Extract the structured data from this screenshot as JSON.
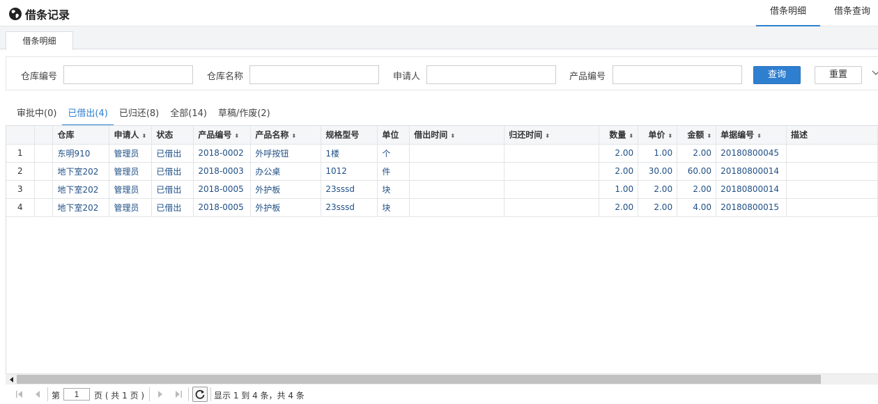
{
  "app": {
    "title": "借条记录"
  },
  "top_tabs": [
    {
      "label": "借条明细",
      "active": true
    },
    {
      "label": "借条查询",
      "active": false
    }
  ],
  "sub_tab": {
    "label": "借条明细"
  },
  "search": {
    "fields": [
      {
        "label": "仓库编号",
        "value": ""
      },
      {
        "label": "仓库名称",
        "value": ""
      },
      {
        "label": "申请人",
        "value": ""
      },
      {
        "label": "产品编号",
        "value": ""
      }
    ],
    "query_label": "查询",
    "reset_label": "重置"
  },
  "status_tabs": [
    {
      "label": "审批中(0)",
      "active": false
    },
    {
      "label": "已借出(4)",
      "active": true
    },
    {
      "label": "已归还(8)",
      "active": false
    },
    {
      "label": "全部(14)",
      "active": false
    },
    {
      "label": "草稿/作废(2)",
      "active": false
    }
  ],
  "table": {
    "columns": [
      {
        "label": "",
        "sortable": false
      },
      {
        "label": "",
        "sortable": false
      },
      {
        "label": "仓库",
        "sortable": false
      },
      {
        "label": "申请人",
        "sortable": true
      },
      {
        "label": "状态",
        "sortable": false
      },
      {
        "label": "产品编号",
        "sortable": true
      },
      {
        "label": "产品名称",
        "sortable": true
      },
      {
        "label": "规格型号",
        "sortable": false
      },
      {
        "label": "单位",
        "sortable": false
      },
      {
        "label": "借出时间",
        "sortable": true
      },
      {
        "label": "归还时间",
        "sortable": true
      },
      {
        "label": "数量",
        "sortable": true
      },
      {
        "label": "单价",
        "sortable": true
      },
      {
        "label": "金额",
        "sortable": true
      },
      {
        "label": "单据编号",
        "sortable": true
      },
      {
        "label": "描述",
        "sortable": false
      }
    ],
    "rows": [
      [
        "1",
        "",
        "东明910",
        "管理员",
        "已借出",
        "2018-0002",
        "外呼按钮",
        "1楼",
        "个",
        "",
        "",
        "2.00",
        "1.00",
        "2.00",
        "20180800045",
        ""
      ],
      [
        "2",
        "",
        "地下室202",
        "管理员",
        "已借出",
        "2018-0003",
        "办公桌",
        "1012",
        "件",
        "",
        "",
        "2.00",
        "30.00",
        "60.00",
        "20180800014",
        ""
      ],
      [
        "3",
        "",
        "地下室202",
        "管理员",
        "已借出",
        "2018-0005",
        "外护板",
        "23sssd",
        "块",
        "",
        "",
        "1.00",
        "2.00",
        "2.00",
        "20180800014",
        ""
      ],
      [
        "4",
        "",
        "地下室202",
        "管理员",
        "已借出",
        "2018-0005",
        "外护板",
        "23sssd",
        "块",
        "",
        "",
        "2.00",
        "2.00",
        "4.00",
        "20180800015",
        ""
      ]
    ]
  },
  "pager": {
    "page_prefix": "第",
    "page_value": "1",
    "page_suffix": "页 ( 共 1 页 )",
    "summary": "显示 1 到 4 条，共 4 条"
  },
  "colors": {
    "accent": "#2f7fd0",
    "link_text": "#1f4f86"
  },
  "icons": {
    "brand": "globe-icon",
    "collapse": "chevron-down-icon",
    "sort": "sort-icon",
    "first": "first-page-icon",
    "prev": "prev-page-icon",
    "next": "next-page-icon",
    "last": "last-page-icon",
    "refresh": "refresh-icon"
  }
}
